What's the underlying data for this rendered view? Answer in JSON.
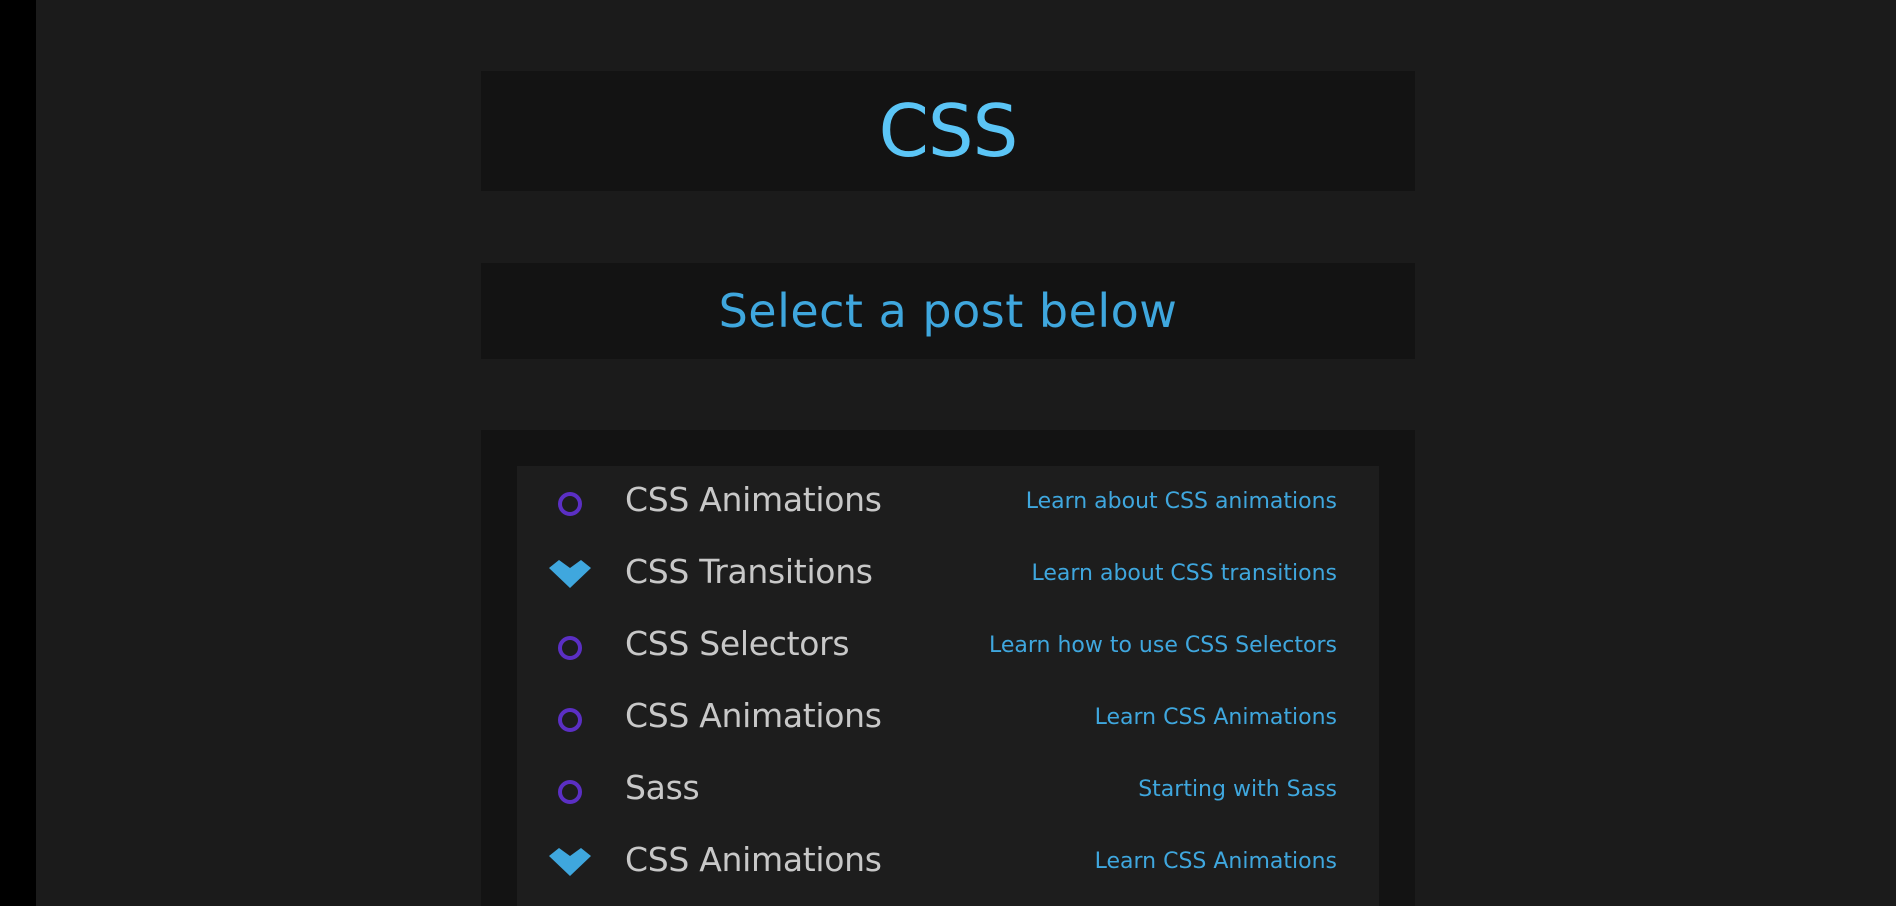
{
  "header": {
    "title": "CSS",
    "subtitle": "Select a post below"
  },
  "colors": {
    "title": "#5bc5f6",
    "subtitle": "#3fa7de",
    "post_title": "#c8c8c8",
    "link": "#3fa7de",
    "circle_icon": "#5b2fc4",
    "heart_icon": "#3fa7de"
  },
  "posts": [
    {
      "icon": "circle-icon",
      "title": "CSS Animations",
      "link": "Learn about CSS animations"
    },
    {
      "icon": "heart-icon",
      "title": "CSS Transitions",
      "link": "Learn about CSS transitions"
    },
    {
      "icon": "circle-icon",
      "title": "CSS Selectors",
      "link": "Learn how to use CSS Selectors"
    },
    {
      "icon": "circle-icon",
      "title": "CSS Animations",
      "link": "Learn CSS Animations"
    },
    {
      "icon": "circle-icon",
      "title": "Sass",
      "link": "Starting with Sass"
    },
    {
      "icon": "heart-icon",
      "title": "CSS Animations",
      "link": "Learn CSS Animations"
    }
  ]
}
